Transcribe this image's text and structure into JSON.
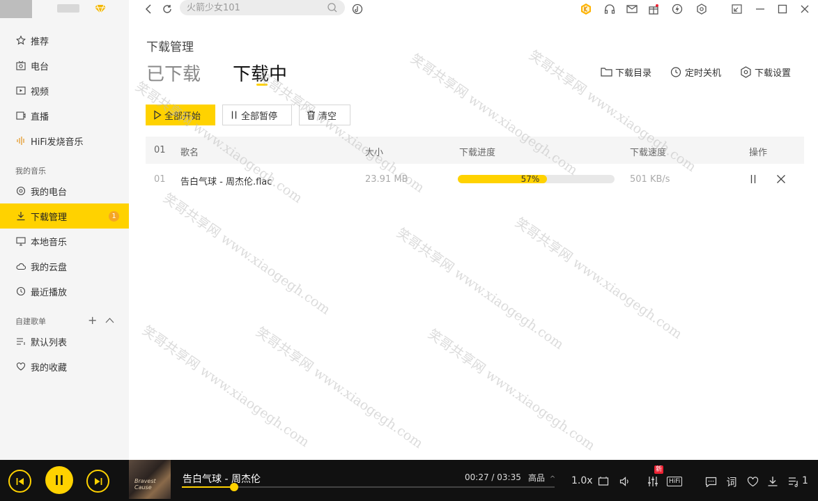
{
  "search": {
    "placeholder": "火箭少女101"
  },
  "sidebar": {
    "items": [
      {
        "label": "推荐",
        "icon": "star-icon"
      },
      {
        "label": "电台",
        "icon": "radio-icon"
      },
      {
        "label": "视频",
        "icon": "video-icon"
      },
      {
        "label": "直播",
        "icon": "live-icon"
      },
      {
        "label": "HiFi发烧音乐",
        "icon": "hifi-icon"
      }
    ],
    "my_music_title": "我的音乐",
    "my_music": [
      {
        "label": "我的电台",
        "icon": "radio-wave-icon"
      },
      {
        "label": "下载管理",
        "icon": "download-icon",
        "badge": "1"
      },
      {
        "label": "本地音乐",
        "icon": "monitor-icon"
      },
      {
        "label": "我的云盘",
        "icon": "cloud-icon"
      },
      {
        "label": "最近播放",
        "icon": "clock-icon"
      }
    ],
    "playlist_title": "自建歌单",
    "playlists": [
      {
        "label": "默认列表",
        "icon": "list-icon"
      },
      {
        "label": "我的收藏",
        "icon": "heart-icon"
      }
    ]
  },
  "main": {
    "page_title": "下载管理",
    "tabs": [
      {
        "label": "已下载"
      },
      {
        "label": "下载中"
      }
    ],
    "header_actions": [
      {
        "label": "下载目录",
        "icon": "folder-icon"
      },
      {
        "label": "定时关机",
        "icon": "timer-icon"
      },
      {
        "label": "下载设置",
        "icon": "settings-icon"
      }
    ],
    "buttons": {
      "start_all": "全部开始",
      "pause_all": "全部暂停",
      "clear": "清空"
    },
    "table": {
      "headers": [
        "01",
        "歌名",
        "大小",
        "下载进度",
        "下载速度",
        "操作"
      ],
      "rows": [
        {
          "index": "01",
          "name": "告白气球 - 周杰伦.flac",
          "size": "23.91 MB",
          "progress": 57,
          "progress_label": "57%",
          "speed": "501 KB/s"
        }
      ]
    }
  },
  "watermarks": [
    "笑哥共享网 www.xiaogegh.com",
    "笑哥共享网 www.xiaogegh.com",
    "笑哥共享网 www.xiaogegh.com",
    "笑哥共享网 www.xiaogegh.com",
    "笑哥共享网 www.xiaogegh.com",
    "笑哥共享网 www.xiaogegh.com",
    "笑哥共享网 www.xiaogegh.com",
    "笑哥共享网 www.xiaogegh.com",
    "笑哥共享网 www.xiaogegh.com",
    "笑哥共享网 www.xiaogegh.com"
  ],
  "player": {
    "song": "告白气球 - 周杰伦",
    "cover_text": "Bravest Cause",
    "time": "00:27 / 03:35",
    "quality": "高品",
    "speed": "1.0x",
    "new_badge": "新",
    "hifi": "HiFi",
    "queue_count": "1",
    "progress_fraction": 0.14
  },
  "colors": {
    "accent": "#ffd200",
    "player_bg": "#111111",
    "sidebar_bg": "#f5f5f5"
  }
}
